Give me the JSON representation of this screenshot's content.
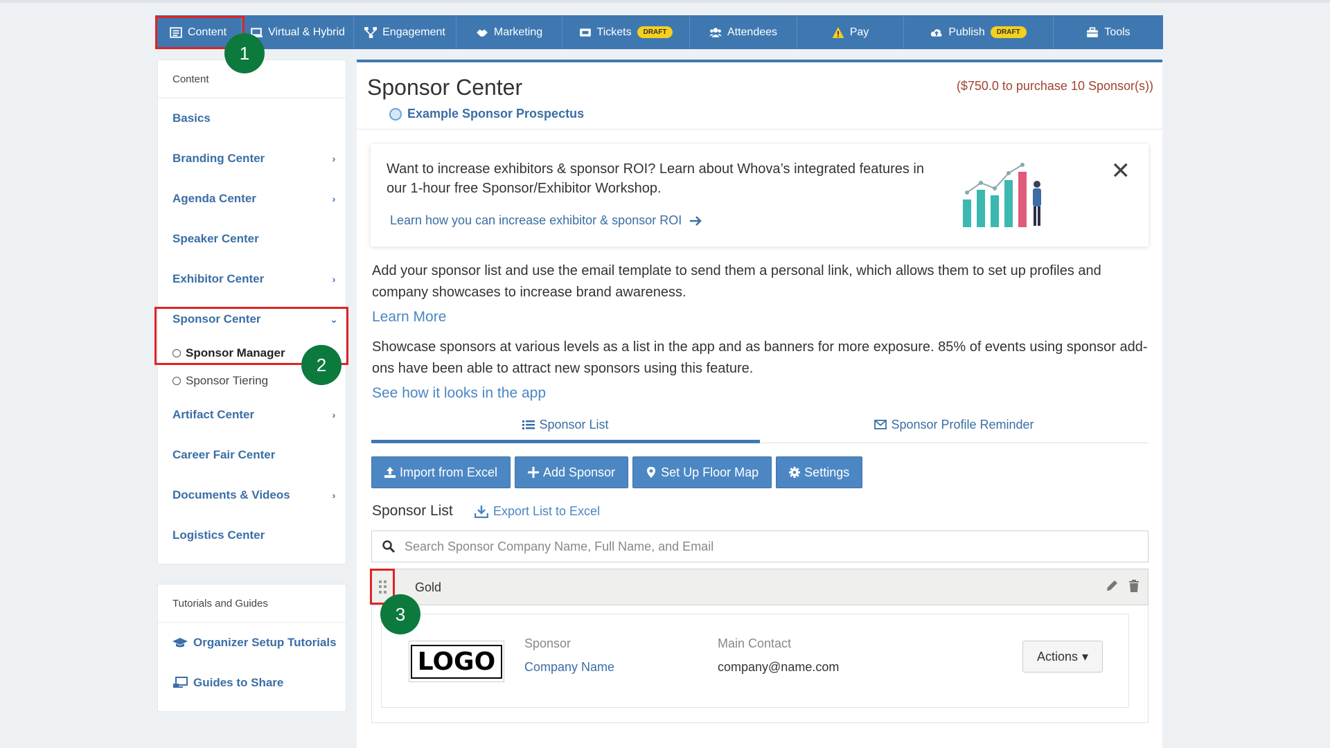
{
  "topnav": {
    "items": [
      {
        "label": "Content",
        "icon": "list-icon"
      },
      {
        "label": "Virtual & Hybrid",
        "icon": "laptop-icon"
      },
      {
        "label": "Engagement",
        "icon": "sitemap-icon"
      },
      {
        "label": "Marketing",
        "icon": "handshake-icon"
      },
      {
        "label": "Tickets",
        "icon": "ticket-icon",
        "badge": "DRAFT"
      },
      {
        "label": "Attendees",
        "icon": "users-icon"
      },
      {
        "label": "Pay",
        "icon": "warning-icon"
      },
      {
        "label": "Publish",
        "icon": "cloud-upload-icon",
        "badge": "DRAFT"
      },
      {
        "label": "Tools",
        "icon": "toolbox-icon"
      }
    ],
    "bg_color": "#3f78b1",
    "badge_color": "#f5d11c"
  },
  "annotations": [
    "1",
    "2",
    "3"
  ],
  "sidebar": {
    "header": "Content",
    "items": [
      {
        "label": "Basics",
        "chevron": ""
      },
      {
        "label": "Branding Center",
        "chevron": "›"
      },
      {
        "label": "Agenda Center",
        "chevron": "›"
      },
      {
        "label": "Speaker Center",
        "chevron": ""
      },
      {
        "label": "Exhibitor Center",
        "chevron": "›"
      },
      {
        "label": "Sponsor Center",
        "chevron": "⌄"
      },
      {
        "label": "Artifact Center",
        "chevron": "›"
      },
      {
        "label": "Career Fair Center",
        "chevron": ""
      },
      {
        "label": "Documents & Videos",
        "chevron": "›"
      },
      {
        "label": "Logistics Center",
        "chevron": ""
      }
    ],
    "sub_items": [
      {
        "label": "Sponsor Manager",
        "active": true
      },
      {
        "label": "Sponsor Tiering",
        "active": false
      }
    ]
  },
  "sidebar2": {
    "header": "Tutorials and Guides",
    "items": [
      {
        "label": "Organizer Setup Tutorials",
        "icon": "graduation-cap-icon"
      },
      {
        "label": "Guides to Share",
        "icon": "share-screen-icon"
      }
    ]
  },
  "main": {
    "title": "Sponsor Center",
    "price_note": "($750.0 to purchase 10 Sponsor(s))",
    "prospectus": "Example Sponsor Prospectus",
    "promo": {
      "text": "Want to increase exhibitors & sponsor ROI? Learn about Whova’s integrated features in our 1-hour free Sponsor/Exhibitor Workshop.",
      "link": "Learn how you can increase exhibitor & sponsor ROI",
      "close": "✕"
    },
    "para1": "Add your sponsor list and use the email template to send them a personal link, which allows them to set up profiles and company showcases to increase brand awareness.",
    "para1_link": "Learn More",
    "para2": "Showcase sponsors at various levels as a list in the app and as banners for more exposure. 85% of events using sponsor add-ons have been able to attract new sponsors using this feature.",
    "para2_link": "See how it looks in the app",
    "tabs": [
      {
        "label": "Sponsor List",
        "active": true
      },
      {
        "label": "Sponsor Profile Reminder",
        "active": false
      }
    ],
    "buttons": [
      {
        "label": "Import from Excel",
        "icon": "upload-icon"
      },
      {
        "label": "Add Sponsor",
        "icon": "plus-icon"
      },
      {
        "label": "Set Up Floor Map",
        "icon": "map-marker-icon"
      },
      {
        "label": "Settings",
        "icon": "gear-icon"
      }
    ],
    "list_label": "Sponsor List",
    "export_label": "Export List to Excel",
    "search_placeholder": "Search Sponsor Company Name, Full Name, and Email",
    "tier": {
      "name": "Gold"
    },
    "sponsor": {
      "logo_text": "LOGO",
      "sponsor_label": "Sponsor",
      "sponsor_value": "Company Name",
      "contact_label": "Main Contact",
      "contact_value": "company@name.com",
      "actions_label": "Actions",
      "actions_caret": "▾"
    }
  }
}
